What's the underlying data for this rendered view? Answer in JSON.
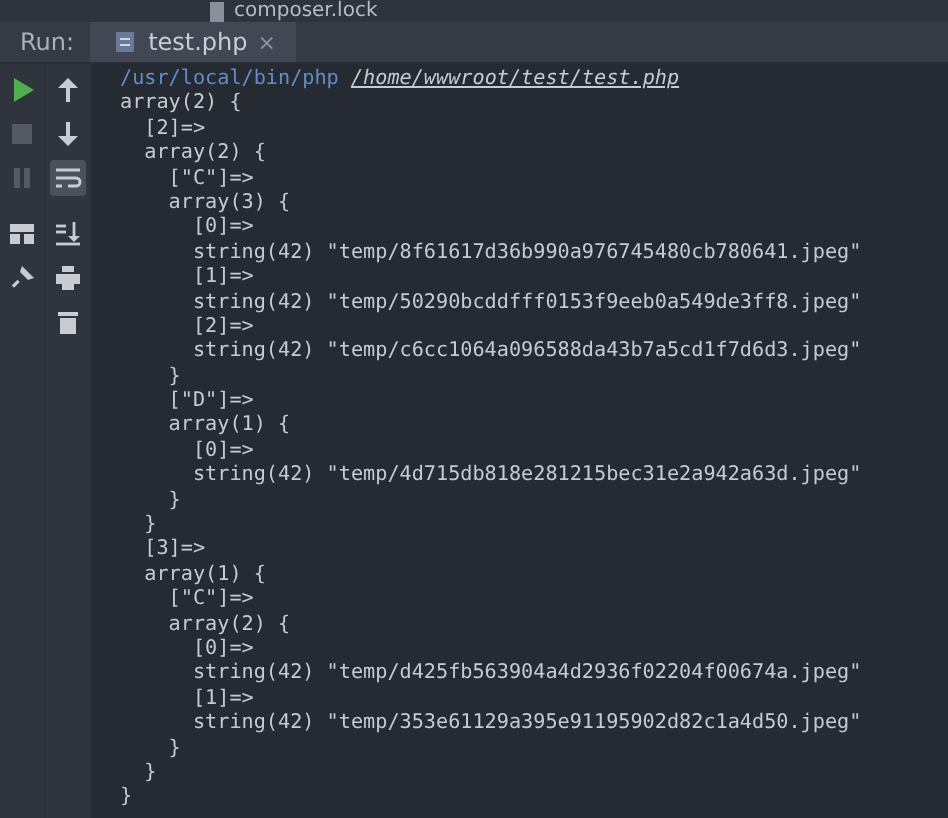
{
  "top_file": {
    "name": "composer.lock"
  },
  "run_bar": {
    "label": "Run:",
    "tabs": [
      {
        "label": "test.php",
        "selected": true,
        "close": "×"
      }
    ]
  },
  "toolbar": {
    "column_1": [
      {
        "kind": "run",
        "disabled": false
      },
      {
        "kind": "stop",
        "disabled": true
      },
      {
        "kind": "pause",
        "disabled": true
      },
      {
        "kind": "layout",
        "disabled": false
      },
      {
        "kind": "pin",
        "disabled": false
      }
    ],
    "column_2": [
      {
        "kind": "up",
        "on": false
      },
      {
        "kind": "down",
        "on": false
      },
      {
        "kind": "wrap",
        "on": true
      },
      {
        "kind": "scroll-end",
        "on": false
      },
      {
        "kind": "print",
        "on": false
      },
      {
        "kind": "trash",
        "on": false
      }
    ]
  },
  "console": {
    "command": "/usr/local/bin/php",
    "script_path": "/home/wwwroot/test/test.php",
    "lines": [
      "array(2) {",
      "  [2]=>",
      "  array(2) {",
      "    [\"C\"]=>",
      "    array(3) {",
      "      [0]=>",
      "      string(42) \"temp/8f61617d36b990a976745480cb780641.jpeg\"",
      "      [1]=>",
      "      string(42) \"temp/50290bcddfff0153f9eeb0a549de3ff8.jpeg\"",
      "      [2]=>",
      "      string(42) \"temp/c6cc1064a096588da43b7a5cd1f7d6d3.jpeg\"",
      "    }",
      "    [\"D\"]=>",
      "    array(1) {",
      "      [0]=>",
      "      string(42) \"temp/4d715db818e281215bec31e2a942a63d.jpeg\"",
      "    }",
      "  }",
      "  [3]=>",
      "  array(1) {",
      "    [\"C\"]=>",
      "    array(2) {",
      "      [0]=>",
      "      string(42) \"temp/d425fb563904a4d2936f02204f00674a.jpeg\"",
      "      [1]=>",
      "      string(42) \"temp/353e61129a395e91195902d82c1a4d50.jpeg\"",
      "    }",
      "  }",
      "}"
    ]
  }
}
